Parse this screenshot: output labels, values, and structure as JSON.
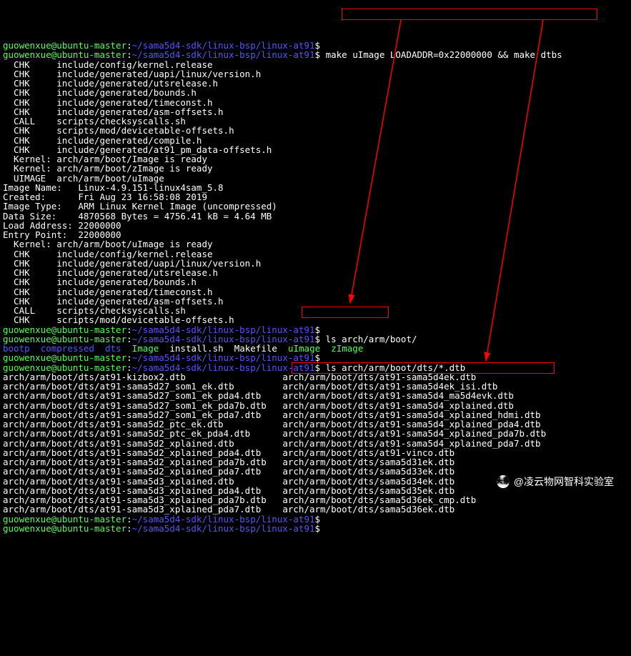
{
  "prompt": {
    "user": "guowenxue@ubuntu-master",
    "sep": ":",
    "path": "~/sama5d4-sdk/linux-bsp/linux-at91",
    "sigil": "$"
  },
  "cmd1": "make uImage LOADADDR=0x22000000 && make dtbs",
  "out1": [
    "  CHK     include/config/kernel.release",
    "  CHK     include/generated/uapi/linux/version.h",
    "  CHK     include/generated/utsrelease.h",
    "  CHK     include/generated/bounds.h",
    "  CHK     include/generated/timeconst.h",
    "  CHK     include/generated/asm-offsets.h",
    "  CALL    scripts/checksyscalls.sh",
    "  CHK     scripts/mod/devicetable-offsets.h",
    "  CHK     include/generated/compile.h",
    "  CHK     include/generated/at91_pm_data-offsets.h",
    "  Kernel: arch/arm/boot/Image is ready",
    "  Kernel: arch/arm/boot/zImage is ready",
    "  UIMAGE  arch/arm/boot/uImage",
    "Image Name:   Linux-4.9.151-linux4sam_5.8",
    "Created:      Fri Aug 23 16:58:08 2019",
    "Image Type:   ARM Linux Kernel Image (uncompressed)",
    "Data Size:    4870568 Bytes = 4756.41 kB = 4.64 MB",
    "Load Address: 22000000",
    "Entry Point:  22000000",
    "  Kernel: arch/arm/boot/uImage is ready",
    "  CHK     include/config/kernel.release",
    "  CHK     include/generated/uapi/linux/version.h",
    "  CHK     include/generated/utsrelease.h",
    "  CHK     include/generated/bounds.h",
    "  CHK     include/generated/timeconst.h",
    "  CHK     include/generated/asm-offsets.h",
    "  CALL    scripts/checksyscalls.sh",
    "  CHK     scripts/mod/devicetable-offsets.h"
  ],
  "cmd2": "ls arch/arm/boot/",
  "ls_boot": {
    "bootp": "bootp",
    "compressed": "compressed",
    "dts": "dts",
    "image": "Image",
    "install": "install.sh",
    "makefile": "Makefile",
    "uimage": "uImage",
    "zimage": "zImage"
  },
  "cmd3": "ls arch/arm/boot/dts/*.dtb",
  "dtb_rows": [
    [
      "arch/arm/boot/dts/at91-kizbox2.dtb",
      "arch/arm/boot/dts/at91-sama5d4ek.dtb"
    ],
    [
      "arch/arm/boot/dts/at91-sama5d27_som1_ek.dtb",
      "arch/arm/boot/dts/at91-sama5d4ek_isi.dtb"
    ],
    [
      "arch/arm/boot/dts/at91-sama5d27_som1_ek_pda4.dtb",
      "arch/arm/boot/dts/at91-sama5d4_ma5d4evk.dtb"
    ],
    [
      "arch/arm/boot/dts/at91-sama5d27_som1_ek_pda7b.dtb",
      "arch/arm/boot/dts/at91-sama5d4_xplained.dtb"
    ],
    [
      "arch/arm/boot/dts/at91-sama5d27_som1_ek_pda7.dtb",
      "arch/arm/boot/dts/at91-sama5d4_xplained_hdmi.dtb"
    ],
    [
      "arch/arm/boot/dts/at91-sama5d2_ptc_ek.dtb",
      "arch/arm/boot/dts/at91-sama5d4_xplained_pda4.dtb"
    ],
    [
      "arch/arm/boot/dts/at91-sama5d2_ptc_ek_pda4.dtb",
      "arch/arm/boot/dts/at91-sama5d4_xplained_pda7b.dtb"
    ],
    [
      "arch/arm/boot/dts/at91-sama5d2_xplained.dtb",
      "arch/arm/boot/dts/at91-sama5d4_xplained_pda7.dtb"
    ],
    [
      "arch/arm/boot/dts/at91-sama5d2_xplained_pda4.dtb",
      "arch/arm/boot/dts/at91-vinco.dtb"
    ],
    [
      "arch/arm/boot/dts/at91-sama5d2_xplained_pda7b.dtb",
      "arch/arm/boot/dts/sama5d31ek.dtb"
    ],
    [
      "arch/arm/boot/dts/at91-sama5d2_xplained_pda7.dtb",
      "arch/arm/boot/dts/sama5d33ek.dtb"
    ],
    [
      "arch/arm/boot/dts/at91-sama5d3_xplained.dtb",
      "arch/arm/boot/dts/sama5d34ek.dtb"
    ],
    [
      "arch/arm/boot/dts/at91-sama5d3_xplained_pda4.dtb",
      "arch/arm/boot/dts/sama5d35ek.dtb"
    ],
    [
      "arch/arm/boot/dts/at91-sama5d3_xplained_pda7b.dtb",
      "arch/arm/boot/dts/sama5d36ek_cmp.dtb"
    ],
    [
      "arch/arm/boot/dts/at91-sama5d3_xplained_pda7.dtb",
      "arch/arm/boot/dts/sama5d36ek.dtb"
    ]
  ],
  "watermark": {
    "badge": "头条",
    "at": "@",
    "text": "凌云物网智科实验室"
  }
}
